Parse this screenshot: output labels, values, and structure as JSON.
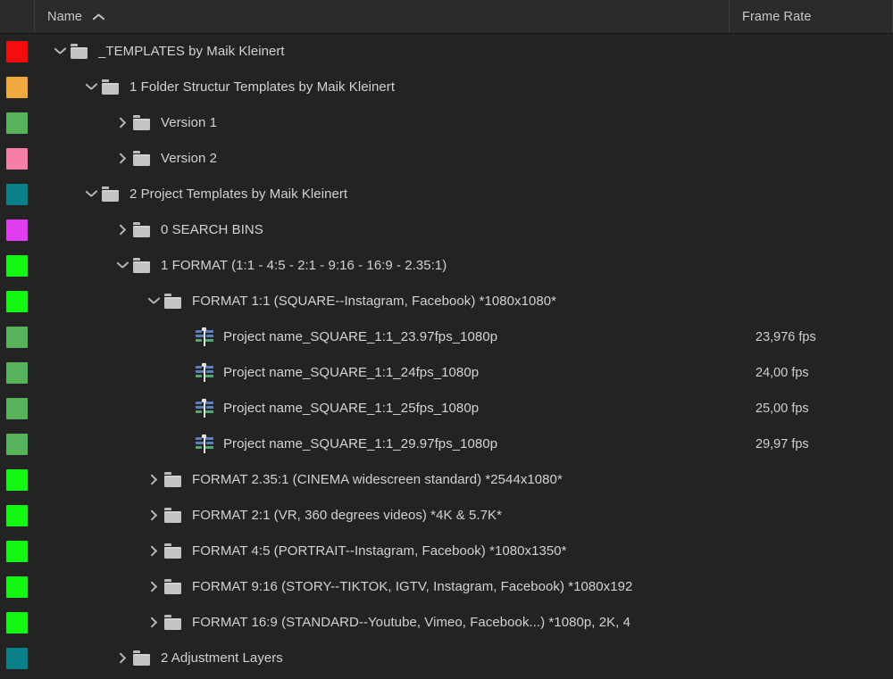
{
  "panel": {
    "name": "project-panel"
  },
  "header": {
    "name_label": "Name",
    "sort_direction": "ascending",
    "sort_icon": "chevron-up-icon",
    "frame_rate_label": "Frame Rate"
  },
  "colors": {
    "panel_background": "#222222",
    "header_background": "#2b2b2b",
    "row_background": "#232323",
    "row_divider": "#2e2e2e",
    "text": "#d2d2d2",
    "header_text": "#c8c8c8",
    "folder_icon": "#c3c3c3",
    "sequence_video_bar": "#5b7fc0",
    "sequence_audio_bar": "#4fa96b",
    "playhead": "#e4e4e4"
  },
  "rows": [
    {
      "label": "_TEMPLATES by Maik Kleinert",
      "type": "folder",
      "icon": "folder-icon",
      "swatch_color": "#f40d0d",
      "swatch_name": "label-color-red",
      "indent": 0,
      "twisty": "open",
      "frame_rate": ""
    },
    {
      "label": "1 Folder Structur Templates by Maik Kleinert",
      "type": "folder",
      "icon": "folder-icon",
      "swatch_color": "#f0a93e",
      "swatch_name": "label-color-orange",
      "indent": 1,
      "twisty": "open",
      "frame_rate": ""
    },
    {
      "label": "Version 1",
      "type": "folder",
      "icon": "folder-icon",
      "swatch_color": "#56b35b",
      "swatch_name": "label-color-green",
      "indent": 2,
      "twisty": "closed",
      "frame_rate": ""
    },
    {
      "label": "Version 2",
      "type": "folder",
      "icon": "folder-icon",
      "swatch_color": "#f67fa5",
      "swatch_name": "label-color-pink",
      "indent": 2,
      "twisty": "closed",
      "frame_rate": ""
    },
    {
      "label": "2 Project Templates by Maik Kleinert",
      "type": "folder",
      "icon": "folder-icon",
      "swatch_color": "#0a8088",
      "swatch_name": "label-color-teal",
      "indent": 1,
      "twisty": "open",
      "frame_rate": ""
    },
    {
      "label": "0 SEARCH BINS",
      "type": "folder",
      "icon": "folder-icon",
      "swatch_color": "#e03cf0",
      "swatch_name": "label-color-magenta",
      "indent": 2,
      "twisty": "closed",
      "frame_rate": ""
    },
    {
      "label": "1 FORMAT (1:1 - 4:5 - 2:1 - 9:16 - 16:9 - 2.35:1)",
      "type": "folder",
      "icon": "folder-icon",
      "swatch_color": "#13f513",
      "swatch_name": "label-color-bright-green",
      "indent": 2,
      "twisty": "open",
      "frame_rate": ""
    },
    {
      "label": "FORMAT 1:1 (SQUARE--Instagram, Facebook) *1080x1080*",
      "type": "folder",
      "icon": "folder-icon",
      "swatch_color": "#13f513",
      "swatch_name": "label-color-bright-green",
      "indent": 3,
      "twisty": "open",
      "frame_rate": ""
    },
    {
      "label": "Project name_SQUARE_1:1_23.97fps_1080p",
      "type": "sequence",
      "icon": "sequence-icon",
      "swatch_color": "#56b35b",
      "swatch_name": "label-color-green",
      "indent": 4,
      "twisty": "none",
      "frame_rate": "23,976 fps"
    },
    {
      "label": "Project name_SQUARE_1:1_24fps_1080p",
      "type": "sequence",
      "icon": "sequence-icon",
      "swatch_color": "#56b35b",
      "swatch_name": "label-color-green",
      "indent": 4,
      "twisty": "none",
      "frame_rate": "24,00 fps"
    },
    {
      "label": "Project name_SQUARE_1:1_25fps_1080p",
      "type": "sequence",
      "icon": "sequence-icon",
      "swatch_color": "#56b35b",
      "swatch_name": "label-color-green",
      "indent": 4,
      "twisty": "none",
      "frame_rate": "25,00 fps"
    },
    {
      "label": "Project name_SQUARE_1:1_29.97fps_1080p",
      "type": "sequence",
      "icon": "sequence-icon",
      "swatch_color": "#56b35b",
      "swatch_name": "label-color-green",
      "indent": 4,
      "twisty": "none",
      "frame_rate": "29,97 fps"
    },
    {
      "label": "FORMAT 2.35:1 (CINEMA widescreen standard) *2544x1080*",
      "type": "folder",
      "icon": "folder-icon",
      "swatch_color": "#13f513",
      "swatch_name": "label-color-bright-green",
      "indent": 3,
      "twisty": "closed",
      "frame_rate": ""
    },
    {
      "label": "FORMAT 2:1 (VR, 360 degrees videos) *4K & 5.7K*",
      "type": "folder",
      "icon": "folder-icon",
      "swatch_color": "#13f513",
      "swatch_name": "label-color-bright-green",
      "indent": 3,
      "twisty": "closed",
      "frame_rate": ""
    },
    {
      "label": "FORMAT 4:5 (PORTRAIT--Instagram, Facebook) *1080x1350*",
      "type": "folder",
      "icon": "folder-icon",
      "swatch_color": "#13f513",
      "swatch_name": "label-color-bright-green",
      "indent": 3,
      "twisty": "closed",
      "frame_rate": ""
    },
    {
      "label": "FORMAT 9:16 (STORY--TIKTOK, IGTV, Instagram, Facebook) *1080x192",
      "type": "folder",
      "icon": "folder-icon",
      "swatch_color": "#13f513",
      "swatch_name": "label-color-bright-green",
      "indent": 3,
      "twisty": "closed",
      "frame_rate": ""
    },
    {
      "label": "FORMAT 16:9 (STANDARD--Youtube, Vimeo, Facebook...) *1080p, 2K, 4",
      "type": "folder",
      "icon": "folder-icon",
      "swatch_color": "#13f513",
      "swatch_name": "label-color-bright-green",
      "indent": 3,
      "twisty": "closed",
      "frame_rate": ""
    },
    {
      "label": "2 Adjustment Layers",
      "type": "folder",
      "icon": "folder-icon",
      "swatch_color": "#0a8088",
      "swatch_name": "label-color-teal",
      "indent": 2,
      "twisty": "closed",
      "frame_rate": ""
    }
  ]
}
